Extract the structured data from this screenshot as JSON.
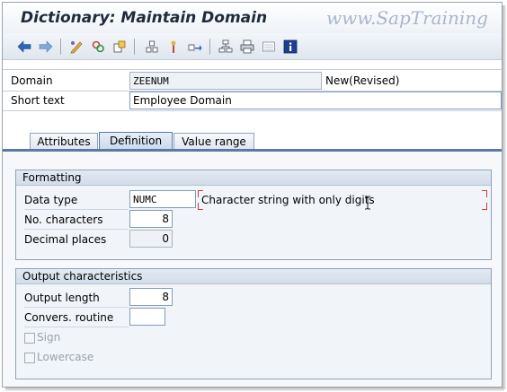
{
  "window": {
    "title": "Dictionary: Maintain Domain",
    "watermark": "www.SapTraining"
  },
  "toolbar": {
    "buttons": [
      {
        "icon": "back-arrow-icon"
      },
      {
        "icon": "forward-arrow-icon"
      },
      {
        "icon": "display-change-icon"
      },
      {
        "icon": "other-object-icon"
      },
      {
        "icon": "check-icon"
      },
      {
        "icon": "activate-icon"
      },
      {
        "icon": "where-used-icon"
      },
      {
        "icon": "object-list-icon"
      },
      {
        "icon": "hierarchy-icon"
      },
      {
        "icon": "print-icon"
      },
      {
        "icon": "display-list-icon"
      },
      {
        "icon": "info-icon"
      }
    ]
  },
  "header": {
    "domain_label": "Domain",
    "domain_value": "ZEENUM",
    "status": "New(Revised)",
    "short_text_label": "Short text",
    "short_text_value": "Employee Domain"
  },
  "tabs": [
    {
      "label": "Attributes",
      "active": false
    },
    {
      "label": "Definition",
      "active": true
    },
    {
      "label": "Value range",
      "active": false
    }
  ],
  "formatting": {
    "title": "Formatting",
    "data_type_label": "Data type",
    "data_type_value": "NUMC",
    "data_type_description": "Character string with only digits",
    "no_characters_label": "No. characters",
    "no_characters_value": "8",
    "decimal_places_label": "Decimal places",
    "decimal_places_value": "0"
  },
  "output": {
    "title": "Output characteristics",
    "output_length_label": "Output length",
    "output_length_value": "8",
    "convers_routine_label": "Convers. routine",
    "convers_routine_value": "",
    "sign_label": "Sign",
    "sign_checked": false,
    "lowercase_label": "Lowercase",
    "lowercase_checked": false
  },
  "colors": {
    "title": "#1f2b3a",
    "watermark": "#a9b6cc",
    "tab_accent": "#5a7aa3",
    "required_marker": "#d23a3a"
  }
}
